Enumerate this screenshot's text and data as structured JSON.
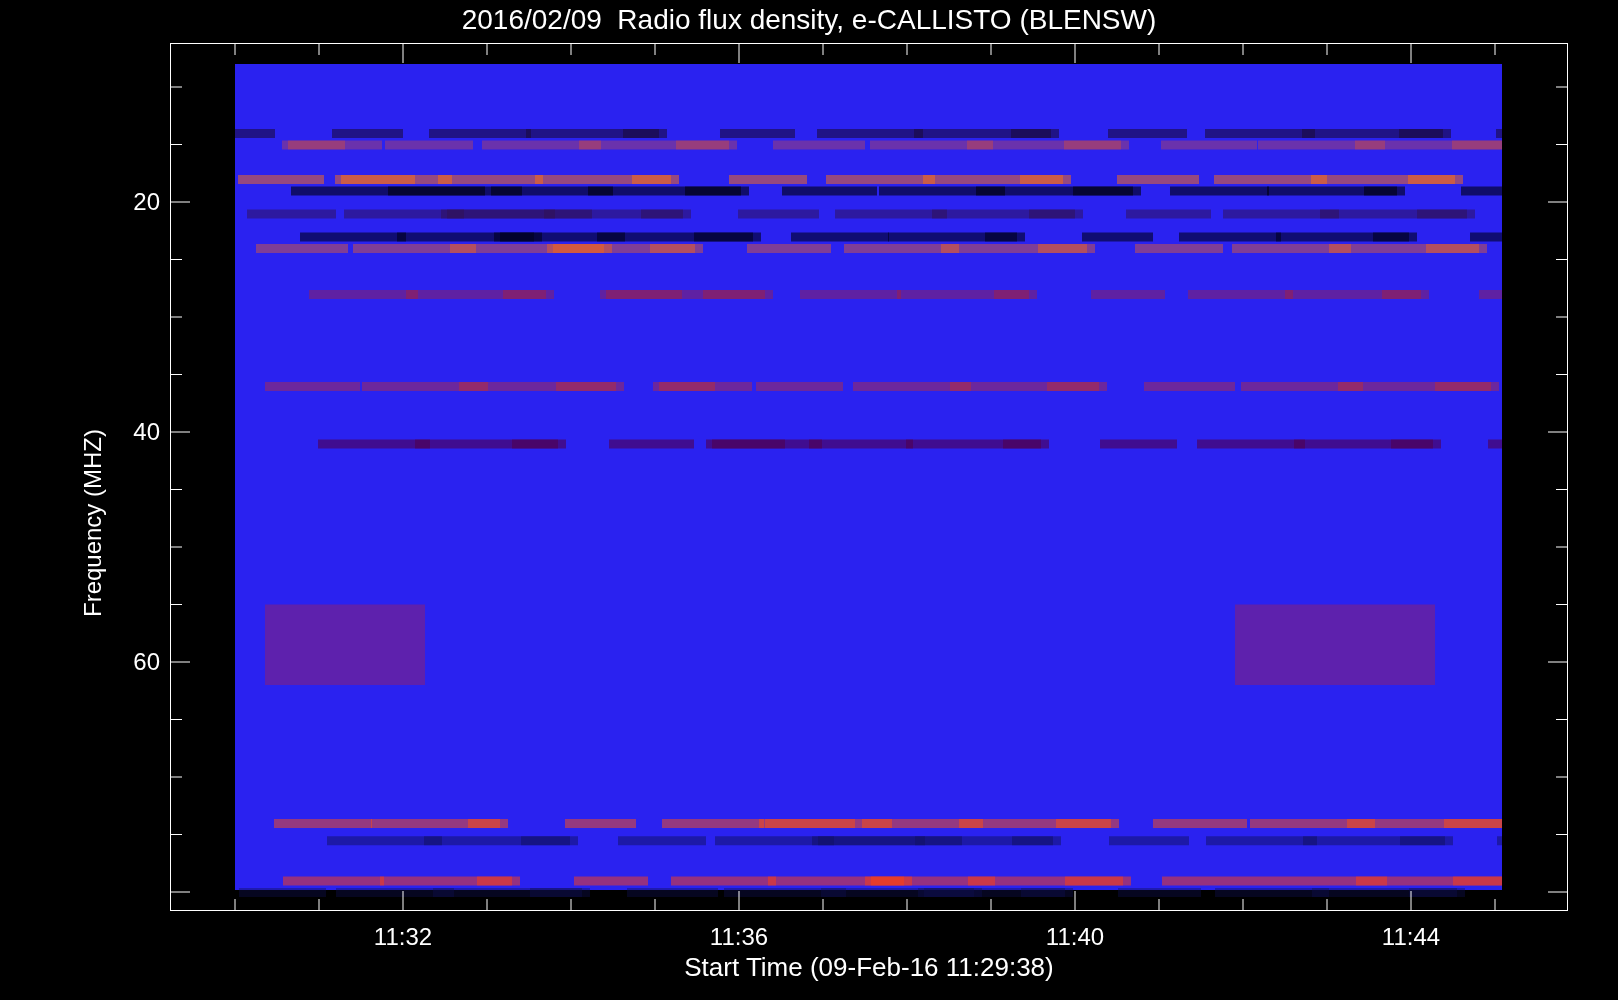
{
  "title": "2016/02/09  Radio flux density, e-CALLISTO (BLENSW)",
  "y_axis": {
    "label": "Frequency (MHZ)",
    "ticks": [
      "20",
      "40",
      "60"
    ]
  },
  "x_axis": {
    "label": "Start Time (09-Feb-16 11:29:38)",
    "ticks": [
      "11:32",
      "11:36",
      "11:40",
      "11:44"
    ]
  }
}
